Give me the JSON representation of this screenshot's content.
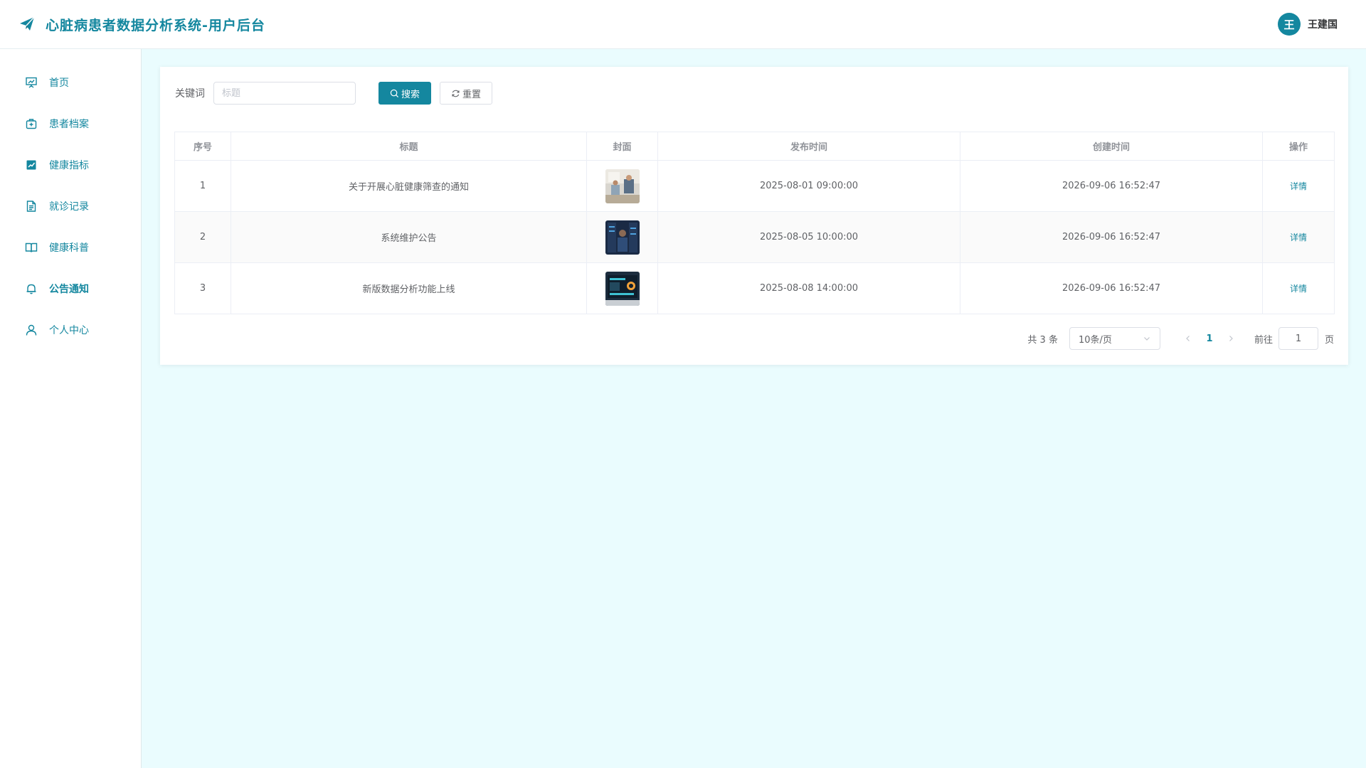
{
  "header": {
    "title": "心脏病患者数据分析系统-用户后台",
    "avatar_initial": "王",
    "username": "王建国"
  },
  "sidebar": {
    "items": [
      {
        "label": "首页",
        "icon": "presentation-chart-icon"
      },
      {
        "label": "患者档案",
        "icon": "medical-kit-icon"
      },
      {
        "label": "健康指标",
        "icon": "trend-chart-icon"
      },
      {
        "label": "就诊记录",
        "icon": "document-icon"
      },
      {
        "label": "健康科普",
        "icon": "open-book-icon"
      },
      {
        "label": "公告通知",
        "icon": "bell-icon",
        "active": true
      },
      {
        "label": "个人中心",
        "icon": "user-icon"
      }
    ]
  },
  "search": {
    "label": "关键词",
    "placeholder": "标题",
    "value": "",
    "search_button": "搜索",
    "reset_button": "重置"
  },
  "table": {
    "headers": [
      "序号",
      "标题",
      "封面",
      "发布时间",
      "创建时间",
      "操作"
    ],
    "rows": [
      {
        "index": "1",
        "title": "关于开展心脏健康筛查的通知",
        "publish_time": "2025-08-01 09:00:00",
        "create_time": "2026-09-06 16:52:47",
        "action": "详情"
      },
      {
        "index": "2",
        "title": "系统维护公告",
        "publish_time": "2025-08-05 10:00:00",
        "create_time": "2026-09-06 16:52:47",
        "action": "详情"
      },
      {
        "index": "3",
        "title": "新版数据分析功能上线",
        "publish_time": "2025-08-08 14:00:00",
        "create_time": "2026-09-06 16:52:47",
        "action": "详情"
      }
    ]
  },
  "pagination": {
    "total_text": "共 3 条",
    "page_size": "10条/页",
    "current_page": "1",
    "goto_label": "前往",
    "goto_value": "1",
    "page_unit": "页"
  },
  "colors": {
    "accent": "#14879f",
    "background": "#eafcfe"
  }
}
